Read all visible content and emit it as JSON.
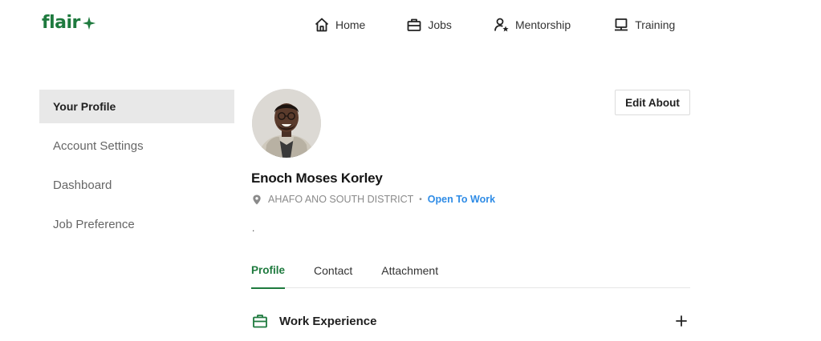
{
  "brand": {
    "logo_text": "flair",
    "accent": "#1e7a3e"
  },
  "nav": {
    "home": "Home",
    "jobs": "Jobs",
    "mentorship": "Mentorship",
    "training": "Training"
  },
  "sidebar": {
    "items": [
      {
        "label": "Your Profile",
        "active": true
      },
      {
        "label": "Account Settings",
        "active": false
      },
      {
        "label": "Dashboard",
        "active": false
      },
      {
        "label": "Job Preference",
        "active": false
      }
    ]
  },
  "profile": {
    "name": "Enoch Moses Korley",
    "location": "AHAFO ANO SOUTH DISTRICT",
    "status": "Open To Work",
    "status_color": "#2f8ce6",
    "bio": ".",
    "edit_label": "Edit About"
  },
  "tabs": [
    {
      "label": "Profile",
      "active": true
    },
    {
      "label": "Contact",
      "active": false
    },
    {
      "label": "Attachment",
      "active": false
    }
  ],
  "sections": {
    "work_experience": "Work Experience"
  },
  "icons": {
    "home": "home-icon",
    "jobs": "briefcase-icon",
    "mentorship": "mentor-icon",
    "training": "training-icon",
    "location": "location-pin-icon",
    "work": "briefcase-icon",
    "add": "plus-icon"
  }
}
